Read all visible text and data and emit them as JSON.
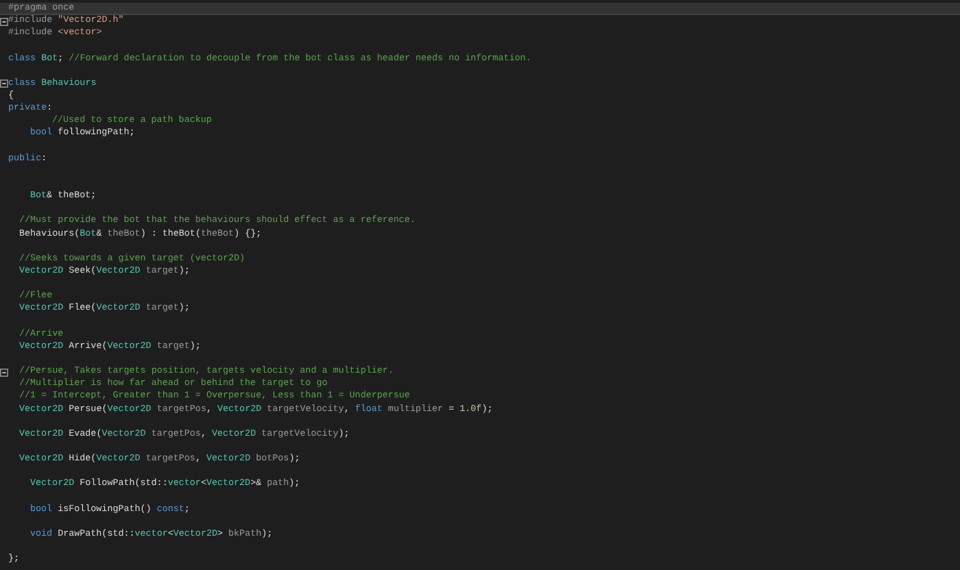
{
  "editor": {
    "lines": [
      {
        "kind": "top",
        "highlighted": true,
        "tokens": [
          {
            "kind": "pp",
            "t": "#pragma once"
          }
        ]
      },
      {
        "kind": "top",
        "highlighted": false,
        "fold": true,
        "tokens": [
          {
            "kind": "pp",
            "t": "#include"
          },
          {
            "kind": "str",
            "t": " \"Vector2D.h\""
          }
        ]
      },
      {
        "kind": "top",
        "highlighted": false,
        "tokens": [
          {
            "kind": "pp",
            "t": "#include"
          },
          {
            "kind": "str",
            "t": " <vector>"
          }
        ]
      },
      {
        "kind": "blank"
      },
      {
        "kind": "top",
        "highlighted": false,
        "tokens": [
          {
            "kind": "kw",
            "t": "class"
          },
          {
            "kind": "type",
            "t": " Bot"
          },
          {
            "kind": "tx",
            "t": ";"
          },
          {
            "kind": "cm",
            "t": " //Forward declaration to decouple from the bot class as header needs no information."
          }
        ]
      },
      {
        "kind": "blank"
      },
      {
        "kind": "top",
        "highlighted": false,
        "fold": true,
        "tokens": [
          {
            "kind": "kw",
            "t": "class"
          },
          {
            "kind": "type",
            "t": " Behaviours"
          }
        ]
      },
      {
        "kind": "top",
        "highlighted": false,
        "tokens": [
          {
            "kind": "tx",
            "t": "{"
          }
        ]
      },
      {
        "kind": "top",
        "highlighted": false,
        "tokens": [
          {
            "kind": "kw",
            "t": "private"
          },
          {
            "kind": "tx",
            "t": ":"
          }
        ]
      },
      {
        "kind": "deep",
        "highlighted": false,
        "tokens": [
          {
            "kind": "cm",
            "t": "//Used to store a path backup"
          }
        ]
      },
      {
        "kind": "inner",
        "highlighted": false,
        "tokens": [
          {
            "kind": "kw",
            "t": "bool"
          },
          {
            "kind": "tx",
            "t": " followingPath;"
          }
        ]
      },
      {
        "kind": "blank"
      },
      {
        "kind": "top",
        "highlighted": false,
        "tokens": [
          {
            "kind": "kw",
            "t": "public"
          },
          {
            "kind": "tx",
            "t": ":"
          }
        ]
      },
      {
        "kind": "blank"
      },
      {
        "kind": "blank"
      },
      {
        "kind": "inner",
        "highlighted": false,
        "tokens": [
          {
            "kind": "type",
            "t": "Bot"
          },
          {
            "kind": "tx",
            "t": "& theBot;"
          }
        ]
      },
      {
        "kind": "blank"
      },
      {
        "kind": "member",
        "highlighted": false,
        "tokens": [
          {
            "kind": "cm",
            "t": "//Must provide the bot that the behaviours should effect as a reference."
          }
        ]
      },
      {
        "kind": "member",
        "highlighted": false,
        "tokens": [
          {
            "kind": "tx",
            "t": "Behaviours("
          },
          {
            "kind": "type",
            "t": "Bot"
          },
          {
            "kind": "tx",
            "t": "&"
          },
          {
            "kind": "param",
            "t": " theBot"
          },
          {
            "kind": "tx",
            "t": ") : theBot("
          },
          {
            "kind": "param",
            "t": "theBot"
          },
          {
            "kind": "tx",
            "t": ") {};"
          }
        ]
      },
      {
        "kind": "blank"
      },
      {
        "kind": "member",
        "highlighted": false,
        "tokens": [
          {
            "kind": "cm",
            "t": "//Seeks towards a given target (vector2D)"
          }
        ]
      },
      {
        "kind": "member",
        "highlighted": false,
        "tokens": [
          {
            "kind": "type",
            "t": "Vector2D"
          },
          {
            "kind": "tx",
            "t": " Seek("
          },
          {
            "kind": "type",
            "t": "Vector2D"
          },
          {
            "kind": "param",
            "t": " target"
          },
          {
            "kind": "tx",
            "t": ");"
          }
        ]
      },
      {
        "kind": "blank"
      },
      {
        "kind": "member",
        "highlighted": false,
        "tokens": [
          {
            "kind": "cm",
            "t": "//Flee"
          }
        ]
      },
      {
        "kind": "member",
        "highlighted": false,
        "tokens": [
          {
            "kind": "type",
            "t": "Vector2D"
          },
          {
            "kind": "tx",
            "t": " Flee("
          },
          {
            "kind": "type",
            "t": "Vector2D"
          },
          {
            "kind": "param",
            "t": " target"
          },
          {
            "kind": "tx",
            "t": ");"
          }
        ]
      },
      {
        "kind": "blank"
      },
      {
        "kind": "member",
        "highlighted": false,
        "tokens": [
          {
            "kind": "cm",
            "t": "//Arrive"
          }
        ]
      },
      {
        "kind": "member",
        "highlighted": false,
        "tokens": [
          {
            "kind": "type",
            "t": "Vector2D"
          },
          {
            "kind": "tx",
            "t": " Arrive("
          },
          {
            "kind": "type",
            "t": "Vector2D"
          },
          {
            "kind": "param",
            "t": " target"
          },
          {
            "kind": "tx",
            "t": ");"
          }
        ]
      },
      {
        "kind": "blank"
      },
      {
        "kind": "member",
        "highlighted": false,
        "fold": true,
        "tokens": [
          {
            "kind": "cm",
            "t": "//Persue, Takes targets position, targets velocity and a multiplier."
          }
        ]
      },
      {
        "kind": "member",
        "highlighted": false,
        "tokens": [
          {
            "kind": "cm",
            "t": "//Multiplier is how far ahead or behind the target to go"
          }
        ]
      },
      {
        "kind": "member",
        "highlighted": false,
        "tokens": [
          {
            "kind": "cm",
            "t": "//1 = Intercept, Greater than 1 = Overpersue, Less than 1 = Underpersue"
          }
        ]
      },
      {
        "kind": "member",
        "highlighted": false,
        "tokens": [
          {
            "kind": "type",
            "t": "Vector2D"
          },
          {
            "kind": "tx",
            "t": " Persue("
          },
          {
            "kind": "type",
            "t": "Vector2D"
          },
          {
            "kind": "param",
            "t": " targetPos"
          },
          {
            "kind": "tx",
            "t": ","
          },
          {
            "kind": "type",
            "t": " Vector2D"
          },
          {
            "kind": "param",
            "t": " targetVelocity"
          },
          {
            "kind": "tx",
            "t": ","
          },
          {
            "kind": "kw",
            "t": " float"
          },
          {
            "kind": "param",
            "t": " multiplier"
          },
          {
            "kind": "tx",
            "t": " ="
          },
          {
            "kind": "num",
            "t": " 1.0f"
          },
          {
            "kind": "tx",
            "t": ");"
          }
        ]
      },
      {
        "kind": "blank"
      },
      {
        "kind": "member",
        "highlighted": false,
        "tokens": [
          {
            "kind": "type",
            "t": "Vector2D"
          },
          {
            "kind": "tx",
            "t": " Evade("
          },
          {
            "kind": "type",
            "t": "Vector2D"
          },
          {
            "kind": "param",
            "t": " targetPos"
          },
          {
            "kind": "tx",
            "t": ","
          },
          {
            "kind": "type",
            "t": " Vector2D"
          },
          {
            "kind": "param",
            "t": " targetVelocity"
          },
          {
            "kind": "tx",
            "t": ");"
          }
        ]
      },
      {
        "kind": "blank"
      },
      {
        "kind": "member",
        "highlighted": false,
        "tokens": [
          {
            "kind": "type",
            "t": "Vector2D"
          },
          {
            "kind": "tx",
            "t": " Hide("
          },
          {
            "kind": "type",
            "t": "Vector2D"
          },
          {
            "kind": "param",
            "t": " targetPos"
          },
          {
            "kind": "tx",
            "t": ","
          },
          {
            "kind": "type",
            "t": " Vector2D"
          },
          {
            "kind": "param",
            "t": " botPos"
          },
          {
            "kind": "tx",
            "t": ");"
          }
        ]
      },
      {
        "kind": "blank"
      },
      {
        "kind": "inner",
        "highlighted": false,
        "tokens": [
          {
            "kind": "type",
            "t": "Vector2D"
          },
          {
            "kind": "tx",
            "t": " FollowPath(std::"
          },
          {
            "kind": "type",
            "t": "vector"
          },
          {
            "kind": "tx",
            "t": "<"
          },
          {
            "kind": "type",
            "t": "Vector2D"
          },
          {
            "kind": "tx",
            "t": ">&"
          },
          {
            "kind": "param",
            "t": " path"
          },
          {
            "kind": "tx",
            "t": ");"
          }
        ]
      },
      {
        "kind": "blank"
      },
      {
        "kind": "inner",
        "highlighted": false,
        "tokens": [
          {
            "kind": "kw",
            "t": "bool"
          },
          {
            "kind": "tx",
            "t": " isFollowingPath()"
          },
          {
            "kind": "kw",
            "t": " const"
          },
          {
            "kind": "tx",
            "t": ";"
          }
        ]
      },
      {
        "kind": "blank"
      },
      {
        "kind": "inner",
        "highlighted": false,
        "tokens": [
          {
            "kind": "kw",
            "t": "void"
          },
          {
            "kind": "tx",
            "t": " DrawPath(std::"
          },
          {
            "kind": "type",
            "t": "vector"
          },
          {
            "kind": "tx",
            "t": "<"
          },
          {
            "kind": "type",
            "t": "Vector2D"
          },
          {
            "kind": "tx",
            "t": ">"
          },
          {
            "kind": "param",
            "t": " bkPath"
          },
          {
            "kind": "tx",
            "t": ");"
          }
        ]
      },
      {
        "kind": "blank"
      },
      {
        "kind": "top",
        "highlighted": false,
        "tokens": [
          {
            "kind": "tx",
            "t": "};"
          }
        ]
      }
    ]
  }
}
